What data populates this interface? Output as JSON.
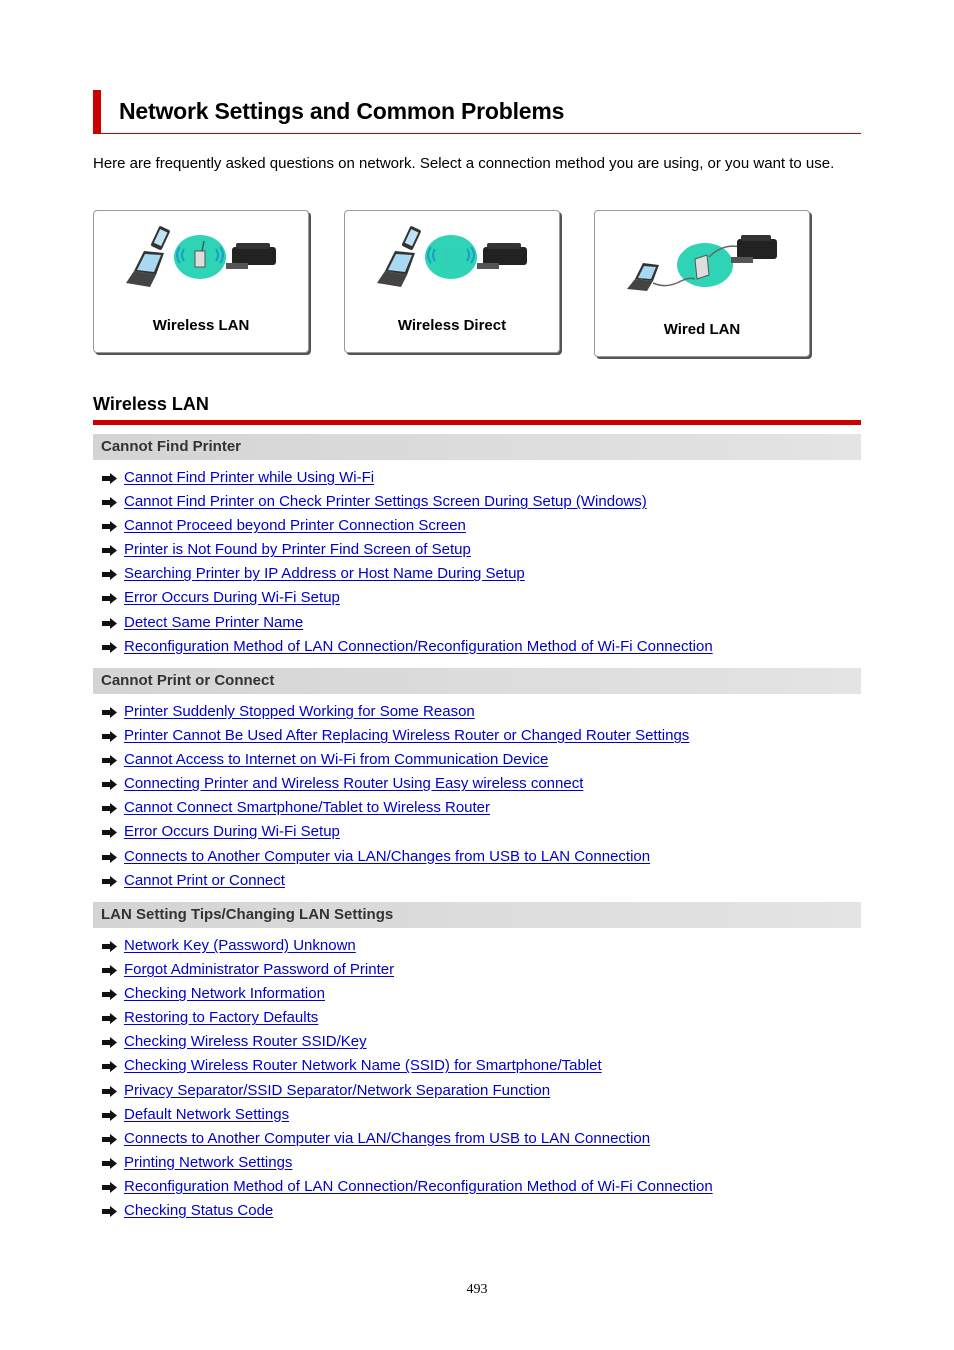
{
  "title": "Network Settings and Common Problems",
  "intro": "Here are frequently asked questions on network. Select a connection method you are using, or you want to use.",
  "connection_methods": [
    {
      "label": "Wireless LAN",
      "icon": "wireless-lan-diagram"
    },
    {
      "label": "Wireless Direct",
      "icon": "wireless-direct-diagram"
    },
    {
      "label": "Wired LAN",
      "icon": "wired-lan-diagram"
    }
  ],
  "section": {
    "title": "Wireless LAN",
    "groups": [
      {
        "header": "Cannot Find Printer",
        "links": [
          "Cannot Find Printer while Using Wi-Fi",
          "Cannot Find Printer on Check Printer Settings Screen During Setup (Windows)",
          "Cannot Proceed beyond Printer Connection Screen",
          "Printer is Not Found by Printer Find Screen of Setup",
          "Searching Printer by IP Address or Host Name During Setup",
          "Error Occurs During Wi-Fi Setup",
          "Detect Same Printer Name",
          "Reconfiguration Method of LAN Connection/Reconfiguration Method of Wi-Fi Connection"
        ]
      },
      {
        "header": "Cannot Print or Connect",
        "links": [
          "Printer Suddenly Stopped Working for Some Reason",
          "Printer Cannot Be Used After Replacing Wireless Router or Changed Router Settings",
          "Cannot Access to Internet on Wi-Fi from Communication Device",
          "Connecting Printer and Wireless Router Using Easy wireless connect",
          "Cannot Connect Smartphone/Tablet to Wireless Router",
          "Error Occurs During Wi-Fi Setup",
          "Connects to Another Computer via LAN/Changes from USB to LAN Connection",
          "Cannot Print or Connect"
        ]
      },
      {
        "header": "LAN Setting Tips/Changing LAN Settings",
        "links": [
          "Network Key (Password) Unknown",
          "Forgot Administrator Password of Printer",
          "Checking Network Information",
          "Restoring to Factory Defaults",
          "Checking Wireless Router SSID/Key",
          "Checking Wireless Router Network Name (SSID) for Smartphone/Tablet",
          "Privacy Separator/SSID Separator/Network Separation Function",
          "Default Network Settings",
          "Connects to Another Computer via LAN/Changes from USB to LAN Connection",
          "Printing Network Settings",
          "Reconfiguration Method of LAN Connection/Reconfiguration Method of Wi-Fi Connection",
          "Checking Status Code"
        ]
      }
    ]
  },
  "page_number": "493",
  "colors": {
    "accent_red": "#cc0000",
    "link_blue": "#0000cc",
    "wifi_cyan": "#2fd3b5"
  }
}
